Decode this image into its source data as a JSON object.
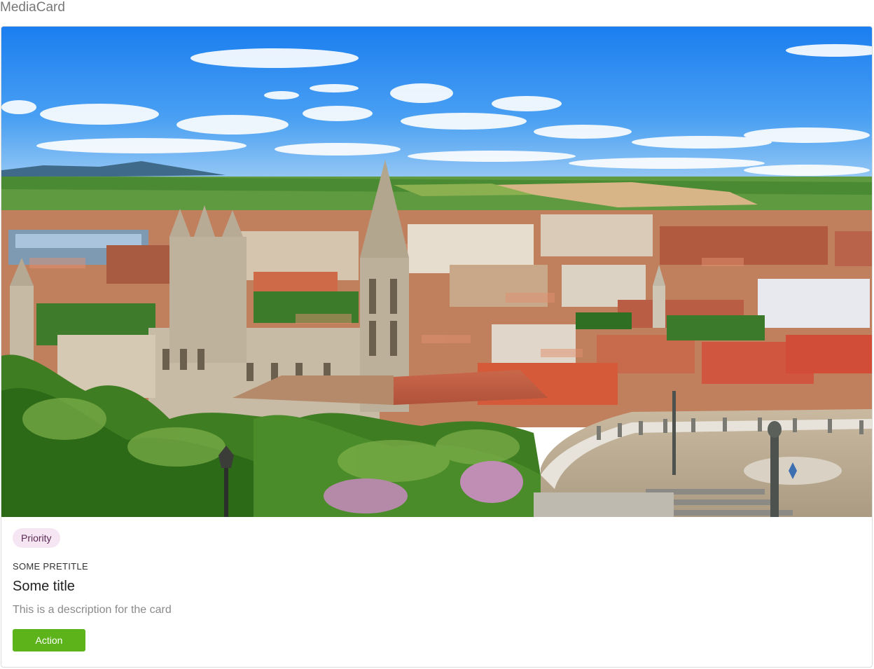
{
  "page": {
    "heading": "MediaCard"
  },
  "card": {
    "badge": "Priority",
    "pretitle": "SOME PRETITLE",
    "title": "Some title",
    "description": "This is a description for the card",
    "action_label": "Action"
  },
  "colors": {
    "action": "#5cb31a",
    "badge_bg": "#f6e6f3",
    "badge_text": "#5a2a52"
  }
}
